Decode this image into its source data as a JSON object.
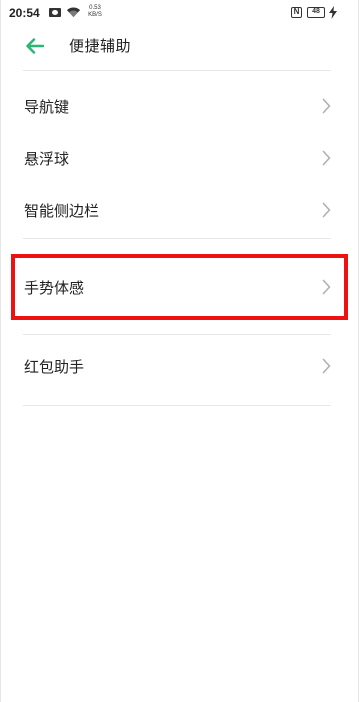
{
  "status_bar": {
    "time": "20:54",
    "net_speed_value": "0.53",
    "net_speed_unit": "KB/S",
    "nfc_label": "N",
    "battery_level": "48",
    "icons": [
      "message-icon",
      "wifi-icon",
      "nfc-icon",
      "battery-icon",
      "charging-icon"
    ]
  },
  "header": {
    "title": "便捷辅助",
    "back_icon": "back-arrow-icon",
    "accent_color": "#2bb673"
  },
  "menu": {
    "items": [
      {
        "label": "导航键"
      },
      {
        "label": "悬浮球"
      },
      {
        "label": "智能侧边栏"
      },
      {
        "label": "手势体感",
        "highlighted": true
      },
      {
        "label": "红包助手"
      }
    ],
    "chevron_icon": "chevron-right-icon"
  },
  "colors": {
    "highlight_border": "#ee1111",
    "divider": "#e8e8e8",
    "text": "#222222",
    "chevron": "#b0b0b0"
  }
}
